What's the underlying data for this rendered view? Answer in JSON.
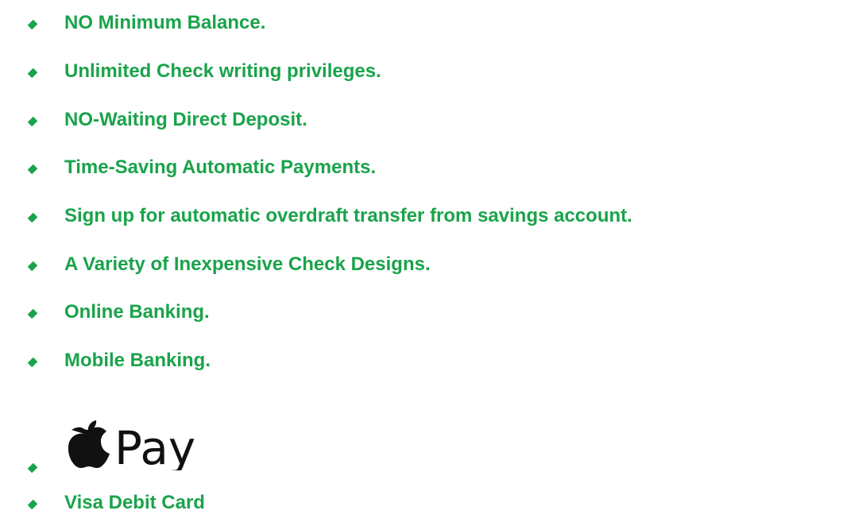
{
  "colors": {
    "text_green": "#1aa34a",
    "bullet_green": "#1aa34a",
    "logo_black": "#111111"
  },
  "features": [
    {
      "label": "NO Minimum Balance."
    },
    {
      "label": "Unlimited Check writing privileges."
    },
    {
      "label": "NO-Waiting Direct Deposit."
    },
    {
      "label": "Time-Saving Automatic Payments."
    },
    {
      "label": "Sign up for automatic overdraft transfer from savings account."
    },
    {
      "label": "A Variety of Inexpensive Check Designs."
    },
    {
      "label": "Online Banking."
    },
    {
      "label": "Mobile Banking."
    }
  ],
  "apple_pay": {
    "logo_text": "Pay",
    "icon": "apple-icon"
  },
  "last_feature": {
    "label": "Visa Debit Card"
  }
}
